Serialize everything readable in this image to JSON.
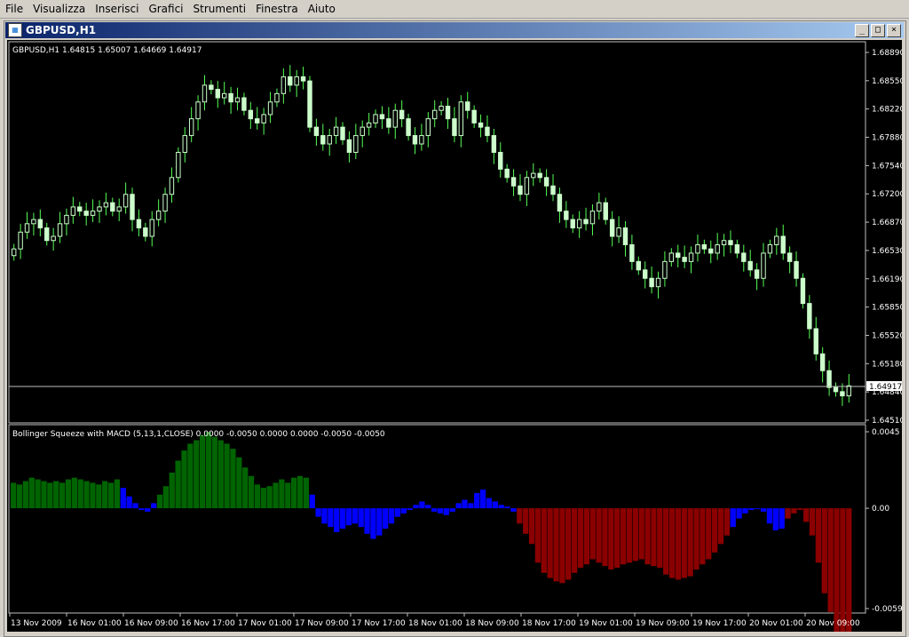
{
  "menu": [
    "File",
    "Visualizza",
    "Inserisci",
    "Grafici",
    "Strumenti",
    "Finestra",
    "Aiuto"
  ],
  "window": {
    "title": "GBPUSD,H1",
    "btn_min": "_",
    "btn_max": "□",
    "btn_close": "×"
  },
  "price_panel": {
    "header": "GBPUSD,H1  1.64815 1.65007 1.64669 1.64917",
    "ticks": [
      "1.68890",
      "1.68550",
      "1.68220",
      "1.67880",
      "1.67540",
      "1.67200",
      "1.66870",
      "1.66530",
      "1.66190",
      "1.65850",
      "1.65520",
      "1.65180",
      "1.64840",
      "1.64510"
    ],
    "current_price": "1.64917",
    "candle_color": "#ccffcc",
    "wick_color": "#55ff55"
  },
  "indicator_panel": {
    "header": "Bollinger Squeeze with MACD (5,13,1,CLOSE) 0.0000 -0.0050 0.0000 0.0000 -0.0050 -0.0050",
    "ticks": [
      "0.0045",
      "0.00",
      "-0.0059"
    ],
    "colors": {
      "green": "#006400",
      "blue": "#0000ff",
      "red": "#8b0000"
    }
  },
  "time_axis": [
    "13 Nov 2009",
    "16 Nov 01:00",
    "16 Nov 09:00",
    "16 Nov 17:00",
    "17 Nov 01:00",
    "17 Nov 09:00",
    "17 Nov 17:00",
    "18 Nov 01:00",
    "18 Nov 09:00",
    "18 Nov 17:00",
    "19 Nov 01:00",
    "19 Nov 09:00",
    "19 Nov 17:00",
    "20 Nov 01:00",
    "20 Nov 09:00"
  ],
  "chart_data": {
    "type": "candlestick",
    "closes": [
      1.6655,
      1.6675,
      1.6685,
      1.669,
      1.668,
      1.6665,
      1.667,
      1.6685,
      1.6695,
      1.6705,
      1.67,
      1.6695,
      1.67,
      1.6705,
      1.671,
      1.67,
      1.6705,
      1.672,
      1.669,
      1.668,
      1.667,
      1.669,
      1.67,
      1.672,
      1.674,
      1.677,
      1.679,
      1.681,
      1.683,
      1.685,
      1.6845,
      1.6835,
      1.684,
      1.683,
      1.6835,
      1.682,
      1.681,
      1.6805,
      1.6815,
      1.683,
      1.684,
      1.686,
      1.685,
      1.686,
      1.6855,
      1.68,
      1.679,
      1.678,
      1.679,
      1.68,
      1.6785,
      1.677,
      1.679,
      1.68,
      1.6805,
      1.6815,
      1.681,
      1.68,
      1.682,
      1.681,
      1.679,
      1.678,
      1.679,
      1.681,
      1.682,
      1.6825,
      1.681,
      1.679,
      1.683,
      1.682,
      1.6805,
      1.68,
      1.679,
      1.677,
      1.675,
      1.674,
      1.673,
      1.672,
      1.674,
      1.6745,
      1.674,
      1.673,
      1.672,
      1.67,
      1.669,
      1.668,
      1.669,
      1.6685,
      1.67,
      1.671,
      1.669,
      1.667,
      1.668,
      1.666,
      1.664,
      1.663,
      1.662,
      1.661,
      1.662,
      1.664,
      1.665,
      1.6645,
      1.664,
      1.665,
      1.666,
      1.6655,
      1.665,
      1.666,
      1.6665,
      1.666,
      1.665,
      1.664,
      1.663,
      1.662,
      1.665,
      1.666,
      1.667,
      1.665,
      1.664,
      1.662,
      1.659,
      1.656,
      1.653,
      1.651,
      1.649,
      1.6485,
      1.648,
      1.6492
    ],
    "histogram": [
      0.0015,
      0.0014,
      0.0016,
      0.0018,
      0.0017,
      0.0016,
      0.0015,
      0.0016,
      0.0015,
      0.0017,
      0.0018,
      0.0017,
      0.0016,
      0.0015,
      0.0014,
      0.0016,
      0.0015,
      0.0017,
      0.0012,
      0.0007,
      0.0003,
      -0.0001,
      -0.0002,
      0.0003,
      0.0008,
      0.0013,
      0.0021,
      0.0028,
      0.0034,
      0.0038,
      0.004,
      0.0043,
      0.0045,
      0.0042,
      0.004,
      0.0038,
      0.0035,
      0.003,
      0.0024,
      0.0019,
      0.0014,
      0.0012,
      0.0013,
      0.0015,
      0.0017,
      0.0015,
      0.0018,
      0.0019,
      0.0018,
      0.0008,
      -0.0005,
      -0.0009,
      -0.0011,
      -0.0014,
      -0.0012,
      -0.001,
      -0.0009,
      -0.0011,
      -0.0015,
      -0.0018,
      -0.0016,
      -0.0012,
      -0.0009,
      -0.0005,
      -0.0003,
      -0.0001,
      0.0002,
      0.0004,
      0.0002,
      -0.0002,
      -0.0003,
      -0.0004,
      -0.0002,
      0.0003,
      0.0005,
      0.0003,
      0.0009,
      0.0011,
      0.0006,
      0.0004,
      0.0002,
      0.0001,
      -0.0002,
      -0.0009,
      -0.0015,
      -0.0021,
      -0.0032,
      -0.0038,
      -0.0041,
      -0.0043,
      -0.0044,
      -0.0042,
      -0.0038,
      -0.0035,
      -0.0033,
      -0.003,
      -0.0032,
      -0.0034,
      -0.0036,
      -0.0035,
      -0.0033,
      -0.0032,
      -0.0031,
      -0.003,
      -0.0033,
      -0.0034,
      -0.0035,
      -0.0039,
      -0.0041,
      -0.0042,
      -0.0041,
      -0.004,
      -0.0036,
      -0.0033,
      -0.003,
      -0.0026,
      -0.0021,
      -0.0016,
      -0.0011,
      -0.0006,
      -0.0003,
      -0.0001,
      0.0,
      -0.0002,
      -0.0009,
      -0.0013,
      -0.0012,
      -0.0006,
      -0.0003,
      -0.0001,
      -0.0008,
      -0.0016,
      -0.0032,
      -0.005,
      -0.0061,
      -0.0074,
      -0.0077,
      -0.0075
    ],
    "price_range": [
      1.6451,
      1.6889
    ],
    "hist_range": [
      -0.0059,
      0.0045
    ]
  }
}
